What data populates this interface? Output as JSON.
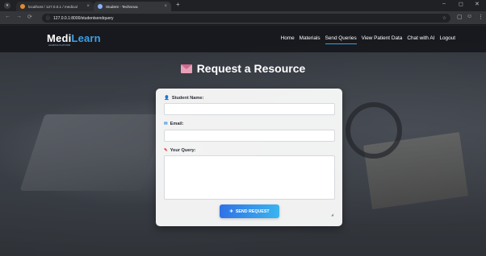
{
  "browser": {
    "tabs": [
      {
        "title": "localhost / 127.0.0.1 / medical",
        "close": "×"
      },
      {
        "title": "Student - Technova",
        "close": "×"
      }
    ],
    "new_tab": "+",
    "menu_icon": "▾",
    "url": "127.0.0.1:8000/studentsendquery",
    "window_controls": [
      "–",
      "◻",
      "✕"
    ],
    "nav": {
      "back": "←",
      "forward": "→",
      "reload": "⟳"
    },
    "star": "☆",
    "toolbar_icons": [
      "▢",
      "☺",
      "⋮"
    ]
  },
  "site": {
    "logo_main": "Medi",
    "logo_accent": "Learn",
    "logo_sub": "LEARNING PLATFORM"
  },
  "nav": {
    "links": [
      "Home",
      "Materials",
      "Send Queries",
      "View Patient Data",
      "Chat with AI",
      "Logout"
    ],
    "active_index": 2
  },
  "page": {
    "heading": "Request a Resource"
  },
  "form": {
    "name_icon": "👤",
    "name_label": "Student Name:",
    "name_value": "",
    "email_icon": "✉",
    "email_label": "Email:",
    "email_value": "",
    "query_icon": "✎",
    "query_label": "Your Query:",
    "query_value": "",
    "submit_icon": "✈",
    "submit_label": "SEND REQUEST"
  },
  "colors": {
    "accent": "#3aa0e8",
    "button_start": "#2f72e6",
    "button_end": "#3ab4f0",
    "navbar": "#14161a"
  }
}
